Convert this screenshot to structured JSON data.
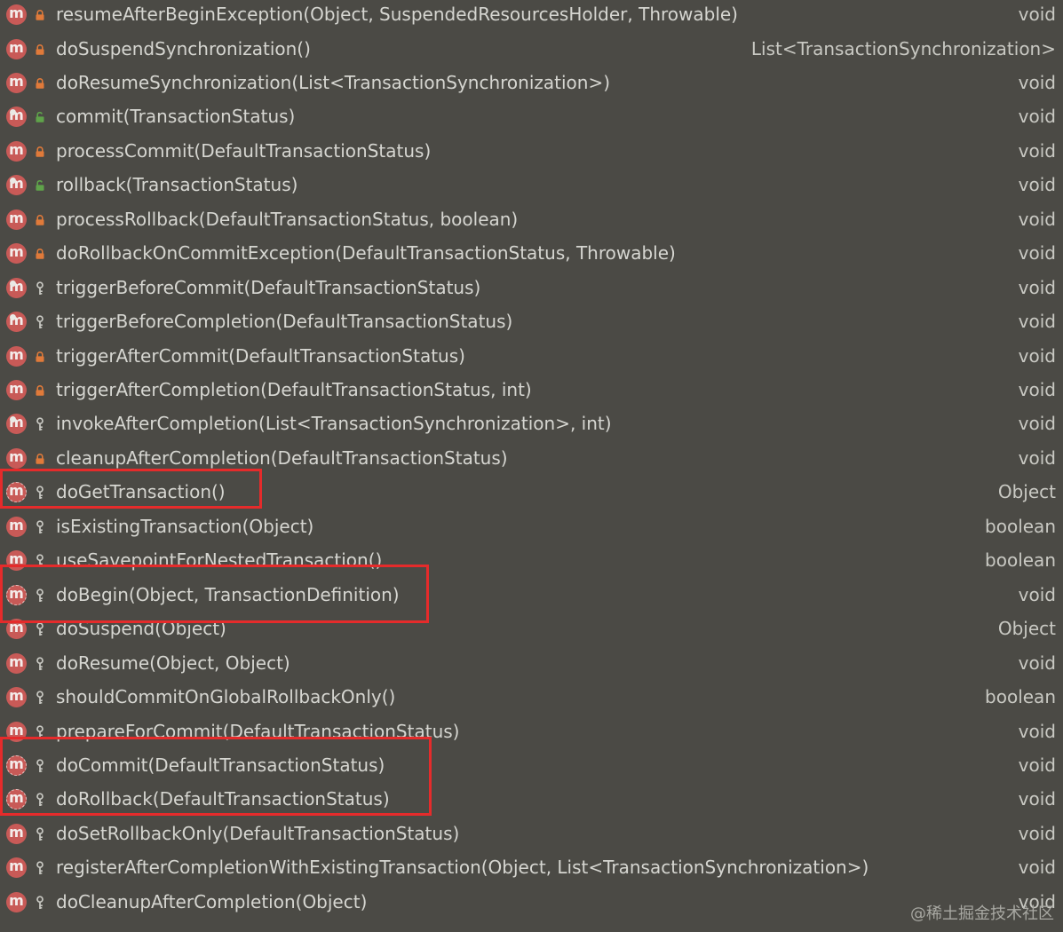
{
  "methods": [
    {
      "signature": "resumeAfterBeginException(Object, SuspendedResourcesHolder, Throwable)",
      "return_type": "void",
      "visibility": "private",
      "abstract": false,
      "overridden": false
    },
    {
      "signature": "doSuspendSynchronization()",
      "return_type": "List<TransactionSynchronization>",
      "visibility": "private",
      "abstract": false,
      "overridden": false
    },
    {
      "signature": "doResumeSynchronization(List<TransactionSynchronization>)",
      "return_type": "void",
      "visibility": "private",
      "abstract": false,
      "overridden": false
    },
    {
      "signature": "commit(TransactionStatus)",
      "return_type": "void",
      "visibility": "public",
      "abstract": false,
      "overridden": true
    },
    {
      "signature": "processCommit(DefaultTransactionStatus)",
      "return_type": "void",
      "visibility": "private",
      "abstract": false,
      "overridden": false
    },
    {
      "signature": "rollback(TransactionStatus)",
      "return_type": "void",
      "visibility": "public",
      "abstract": false,
      "overridden": true
    },
    {
      "signature": "processRollback(DefaultTransactionStatus, boolean)",
      "return_type": "void",
      "visibility": "private",
      "abstract": false,
      "overridden": false
    },
    {
      "signature": "doRollbackOnCommitException(DefaultTransactionStatus, Throwable)",
      "return_type": "void",
      "visibility": "private",
      "abstract": false,
      "overridden": false
    },
    {
      "signature": "triggerBeforeCommit(DefaultTransactionStatus)",
      "return_type": "void",
      "visibility": "protected",
      "abstract": false,
      "overridden": true
    },
    {
      "signature": "triggerBeforeCompletion(DefaultTransactionStatus)",
      "return_type": "void",
      "visibility": "protected",
      "abstract": false,
      "overridden": true
    },
    {
      "signature": "triggerAfterCommit(DefaultTransactionStatus)",
      "return_type": "void",
      "visibility": "private",
      "abstract": false,
      "overridden": false
    },
    {
      "signature": "triggerAfterCompletion(DefaultTransactionStatus, int)",
      "return_type": "void",
      "visibility": "private",
      "abstract": false,
      "overridden": false
    },
    {
      "signature": "invokeAfterCompletion(List<TransactionSynchronization>, int)",
      "return_type": "void",
      "visibility": "protected",
      "abstract": false,
      "overridden": true
    },
    {
      "signature": "cleanupAfterCompletion(DefaultTransactionStatus)",
      "return_type": "void",
      "visibility": "private",
      "abstract": false,
      "overridden": false
    },
    {
      "signature": "doGetTransaction()",
      "return_type": "Object",
      "visibility": "protected",
      "abstract": true,
      "overridden": false
    },
    {
      "signature": "isExistingTransaction(Object)",
      "return_type": "boolean",
      "visibility": "protected",
      "abstract": false,
      "overridden": false
    },
    {
      "signature": "useSavepointForNestedTransaction()",
      "return_type": "boolean",
      "visibility": "protected",
      "abstract": false,
      "overridden": false
    },
    {
      "signature": "doBegin(Object, TransactionDefinition)",
      "return_type": "void",
      "visibility": "protected",
      "abstract": true,
      "overridden": false
    },
    {
      "signature": "doSuspend(Object)",
      "return_type": "Object",
      "visibility": "protected",
      "abstract": false,
      "overridden": false
    },
    {
      "signature": "doResume(Object, Object)",
      "return_type": "void",
      "visibility": "protected",
      "abstract": false,
      "overridden": false
    },
    {
      "signature": "shouldCommitOnGlobalRollbackOnly()",
      "return_type": "boolean",
      "visibility": "protected",
      "abstract": false,
      "overridden": false
    },
    {
      "signature": "prepareForCommit(DefaultTransactionStatus)",
      "return_type": "void",
      "visibility": "protected",
      "abstract": false,
      "overridden": false
    },
    {
      "signature": "doCommit(DefaultTransactionStatus)",
      "return_type": "void",
      "visibility": "protected",
      "abstract": true,
      "overridden": false
    },
    {
      "signature": "doRollback(DefaultTransactionStatus)",
      "return_type": "void",
      "visibility": "protected",
      "abstract": true,
      "overridden": false
    },
    {
      "signature": "doSetRollbackOnly(DefaultTransactionStatus)",
      "return_type": "void",
      "visibility": "protected",
      "abstract": false,
      "overridden": false
    },
    {
      "signature": "registerAfterCompletionWithExistingTransaction(Object, List<TransactionSynchronization>)",
      "return_type": "void",
      "visibility": "protected",
      "abstract": false,
      "overridden": false
    },
    {
      "signature": "doCleanupAfterCompletion(Object)",
      "return_type": "void",
      "visibility": "protected",
      "abstract": false,
      "overridden": false
    }
  ],
  "icons": {
    "method_letter": "m",
    "method_icon": "method-icon",
    "private_icon": "lock-icon",
    "public_icon": "unlock-icon",
    "protected_icon": "key-icon"
  },
  "colors": {
    "background": "#4b4a45",
    "text": "#d6d6d1",
    "method_icon": "#c85a57",
    "private_lock": "#e07a3a",
    "public_lock": "#5fa34a",
    "protected_key": "#c9c9c3",
    "highlight": "#e52b2b"
  },
  "watermark": "@稀土掘金技术社区"
}
